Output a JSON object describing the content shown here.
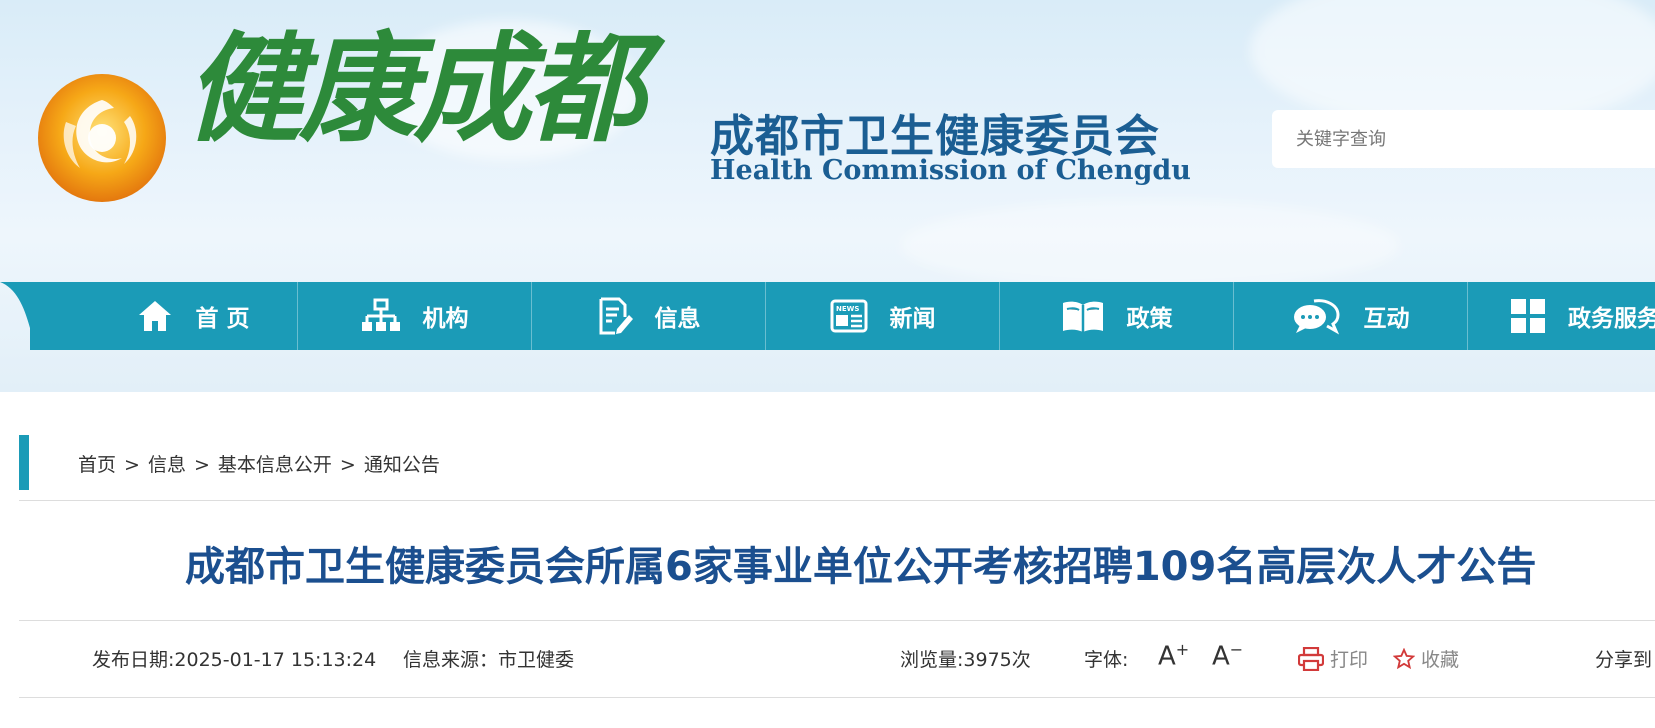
{
  "header": {
    "logo_text": "健康成都",
    "org_name_cn": "成都市卫生健康委员会",
    "org_name_en": "Health Commission of Chengdu",
    "search_placeholder": "关键字查询"
  },
  "nav": {
    "items": [
      {
        "label": "首 页",
        "icon": "home-icon"
      },
      {
        "label": "机构",
        "icon": "org-chart-icon"
      },
      {
        "label": "信息",
        "icon": "document-edit-icon"
      },
      {
        "label": "新闻",
        "icon": "news-icon"
      },
      {
        "label": "政策",
        "icon": "book-icon"
      },
      {
        "label": "互动",
        "icon": "chat-icon"
      },
      {
        "label": "政务服务",
        "icon": "grid-icon"
      }
    ]
  },
  "breadcrumb": {
    "items": [
      "首页",
      "信息",
      "基本信息公开",
      "通知公告"
    ],
    "separator": ">"
  },
  "article": {
    "title": "成都市卫生健康委员会所属6家事业单位公开考核招聘109名高层次人才公告",
    "publish_date": "发布日期:2025-01-17 15:13:24",
    "source": "信息来源：市卫健委",
    "views": "浏览量:3975次",
    "font_label": "字体:",
    "font_increase": "A",
    "font_decrease": "A",
    "print_label": "打印",
    "favorite_label": "收藏",
    "share_label": "分享到"
  },
  "colors": {
    "nav_bg": "#1b9bb7",
    "title": "#1b4f8f",
    "logo_green": "#2d8a3a",
    "org_blue": "#1b5e93",
    "print_icon": "#d23a3a"
  }
}
